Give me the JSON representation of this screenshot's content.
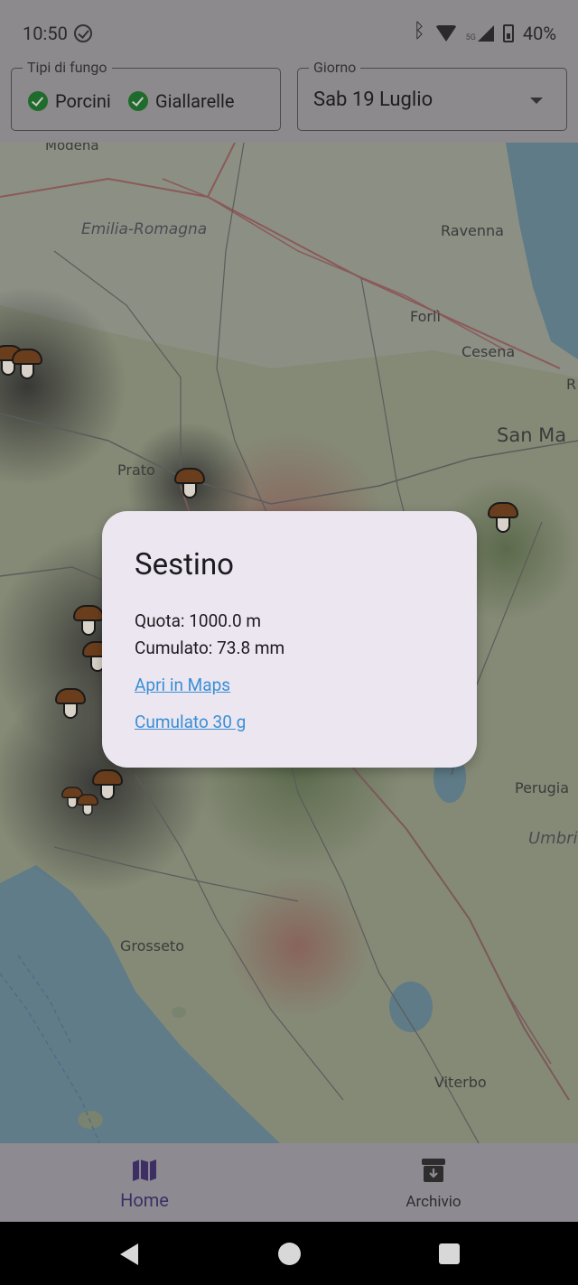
{
  "status_bar": {
    "time": "10:50",
    "network_badge": "5G",
    "battery": "40%",
    "icons": [
      "check-circle-icon",
      "bluetooth-icon",
      "wifi-icon",
      "signal-icon",
      "battery-icon"
    ]
  },
  "filters": {
    "types_label": "Tipi di fungo",
    "types": [
      {
        "label": "Porcini",
        "selected": true
      },
      {
        "label": "Giallarelle",
        "selected": true
      }
    ],
    "day_label": "Giorno",
    "day_value": "Sab 19 Luglio"
  },
  "map": {
    "places": [
      {
        "name": "Modena",
        "style": "city"
      },
      {
        "name": "Emilia-Romagna",
        "style": "region"
      },
      {
        "name": "Ravenna",
        "style": "city"
      },
      {
        "name": "Forlì",
        "style": "city"
      },
      {
        "name": "Cesena",
        "style": "city"
      },
      {
        "name": "San Ma",
        "style": "city"
      },
      {
        "name": "Prato",
        "style": "city"
      },
      {
        "name": "Perugia",
        "style": "city"
      },
      {
        "name": "Umbri",
        "style": "region"
      },
      {
        "name": "Grosseto",
        "style": "city"
      },
      {
        "name": "Viterbo",
        "style": "city"
      },
      {
        "name": "R",
        "style": "city"
      }
    ]
  },
  "dialog": {
    "title": "Sestino",
    "quota": "Quota: 1000.0 m",
    "cumulato": "Cumulato: 73.8 mm",
    "link_maps": "Apri in Maps",
    "link_cumulato": "Cumulato 30 g"
  },
  "bottom_nav": {
    "items": [
      {
        "label": "Home",
        "icon": "map-icon",
        "active": true
      },
      {
        "label": "Archivio",
        "icon": "archive-icon",
        "active": false
      }
    ]
  },
  "colors": {
    "dialog_bg": "#ece6f0",
    "link": "#3a8fd6",
    "chip_check": "#1f6b2b",
    "nav_active": "#3d2f64"
  }
}
